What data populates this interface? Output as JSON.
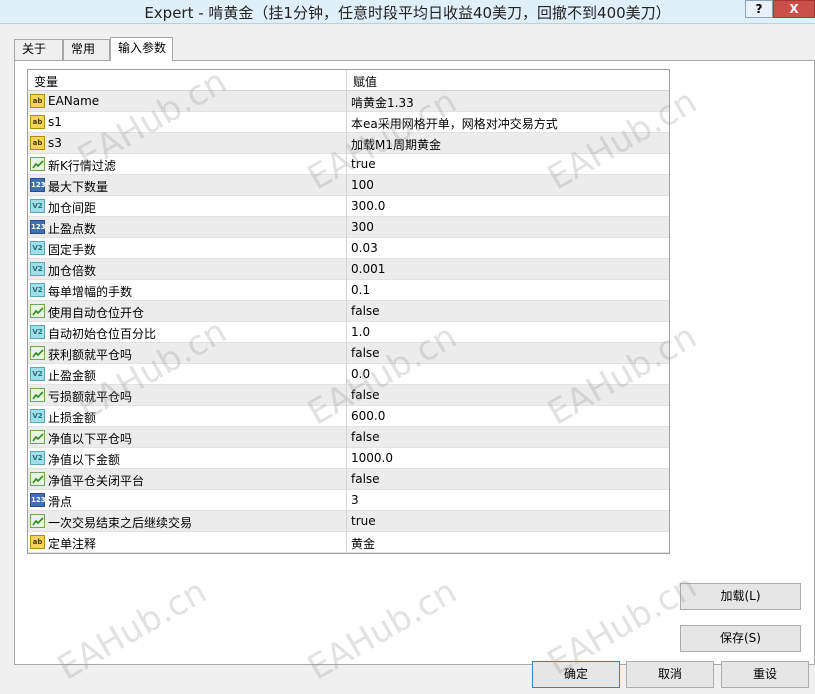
{
  "window": {
    "title": "Expert - 啃黄金（挂1分钟，任意时段平均日收益40美刀，回撤不到400美刀）",
    "help_label": "?",
    "close_label": "X"
  },
  "tabs": [
    {
      "label": "关于"
    },
    {
      "label": "常用"
    },
    {
      "label": "输入参数"
    }
  ],
  "grid": {
    "headers": {
      "variable": "变量",
      "value": "赋值"
    },
    "rows": [
      {
        "type": "ab",
        "name": "EAName",
        "value": "啃黄金1.33"
      },
      {
        "type": "ab",
        "name": "s1",
        "value": "本ea采用网格开单，网格对冲交易方式"
      },
      {
        "type": "ab",
        "name": "s3",
        "value": "加载M1周期黄金"
      },
      {
        "type": "bool",
        "name": "新K行情过滤",
        "value": "true"
      },
      {
        "type": "int",
        "name": "最大下数量",
        "value": "100"
      },
      {
        "type": "dbl",
        "name": "加仓间距",
        "value": "300.0"
      },
      {
        "type": "int",
        "name": "止盈点数",
        "value": "300"
      },
      {
        "type": "dbl",
        "name": "固定手数",
        "value": "0.03"
      },
      {
        "type": "dbl",
        "name": "加仓倍数",
        "value": "0.001"
      },
      {
        "type": "dbl",
        "name": "每单增幅的手数",
        "value": "0.1"
      },
      {
        "type": "bool",
        "name": "使用自动仓位开仓",
        "value": "false"
      },
      {
        "type": "dbl",
        "name": "自动初始仓位百分比",
        "value": "1.0"
      },
      {
        "type": "bool",
        "name": "获利额就平仓吗",
        "value": "false"
      },
      {
        "type": "dbl",
        "name": "止盈金额",
        "value": "0.0"
      },
      {
        "type": "bool",
        "name": "亏损额就平仓吗",
        "value": "false"
      },
      {
        "type": "dbl",
        "name": "止损金额",
        "value": "600.0"
      },
      {
        "type": "bool",
        "name": "净值以下平仓吗",
        "value": "false"
      },
      {
        "type": "dbl",
        "name": "净值以下金额",
        "value": "1000.0"
      },
      {
        "type": "bool",
        "name": "净值平仓关闭平台",
        "value": "false"
      },
      {
        "type": "int",
        "name": "滑点",
        "value": "3"
      },
      {
        "type": "bool",
        "name": "一次交易结束之后继续交易",
        "value": "true"
      },
      {
        "type": "ab",
        "name": "定单注释",
        "value": "黄金"
      }
    ]
  },
  "icons": {
    "ab": "ab",
    "int": "123",
    "dbl": "V2"
  },
  "buttons": {
    "load": "加载(L)",
    "save": "保存(S)",
    "ok": "确定",
    "cancel": "取消",
    "reset": "重设"
  },
  "watermark": "EAHub.cn"
}
